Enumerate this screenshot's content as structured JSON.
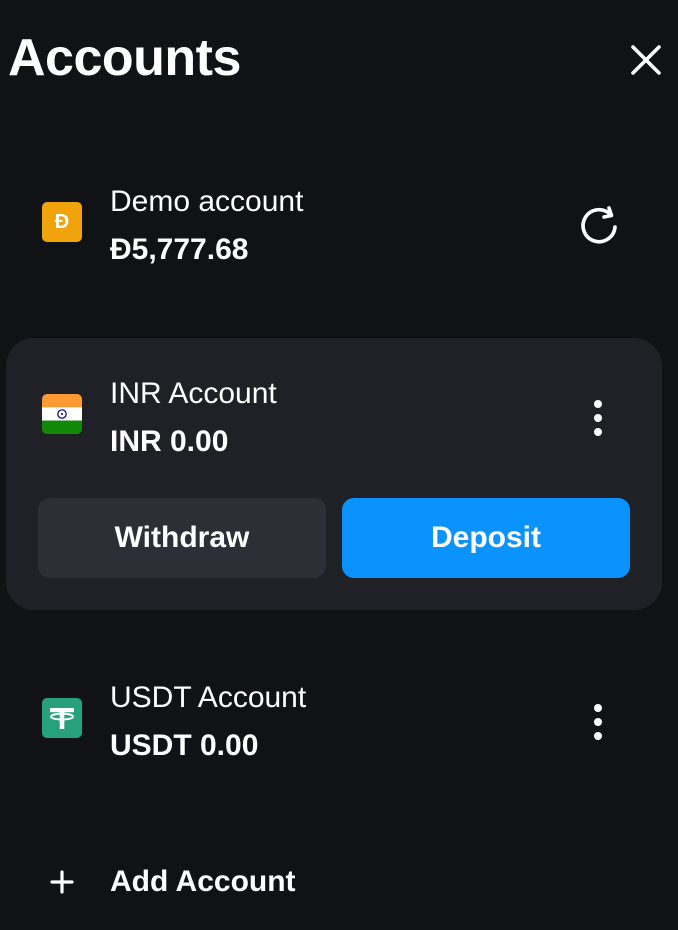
{
  "header": {
    "title": "Accounts",
    "close_icon": "close-icon"
  },
  "accounts": [
    {
      "name": "Demo account",
      "balance": "Đ5,777.68",
      "icon": "demo-coin-icon",
      "icon_glyph": "Đ",
      "action_icon": "refresh-icon"
    },
    {
      "name": "INR Account",
      "balance": "INR 0.00",
      "icon": "india-flag-icon",
      "action_icon": "more-vertical-icon",
      "selected": true
    },
    {
      "name": "USDT Account",
      "balance": "USDT 0.00",
      "icon": "tether-icon",
      "icon_glyph": "₮",
      "action_icon": "more-vertical-icon"
    }
  ],
  "buttons": {
    "withdraw_label": "Withdraw",
    "deposit_label": "Deposit"
  },
  "add_account": {
    "label": "Add Account",
    "icon": "plus-icon"
  },
  "colors": {
    "background": "#111216",
    "card": "#1f2127",
    "withdraw_bg": "#2c2f36",
    "deposit_accent": "#0a93ff",
    "demo_coin": "#f0a30a",
    "tether": "#26a17b"
  }
}
